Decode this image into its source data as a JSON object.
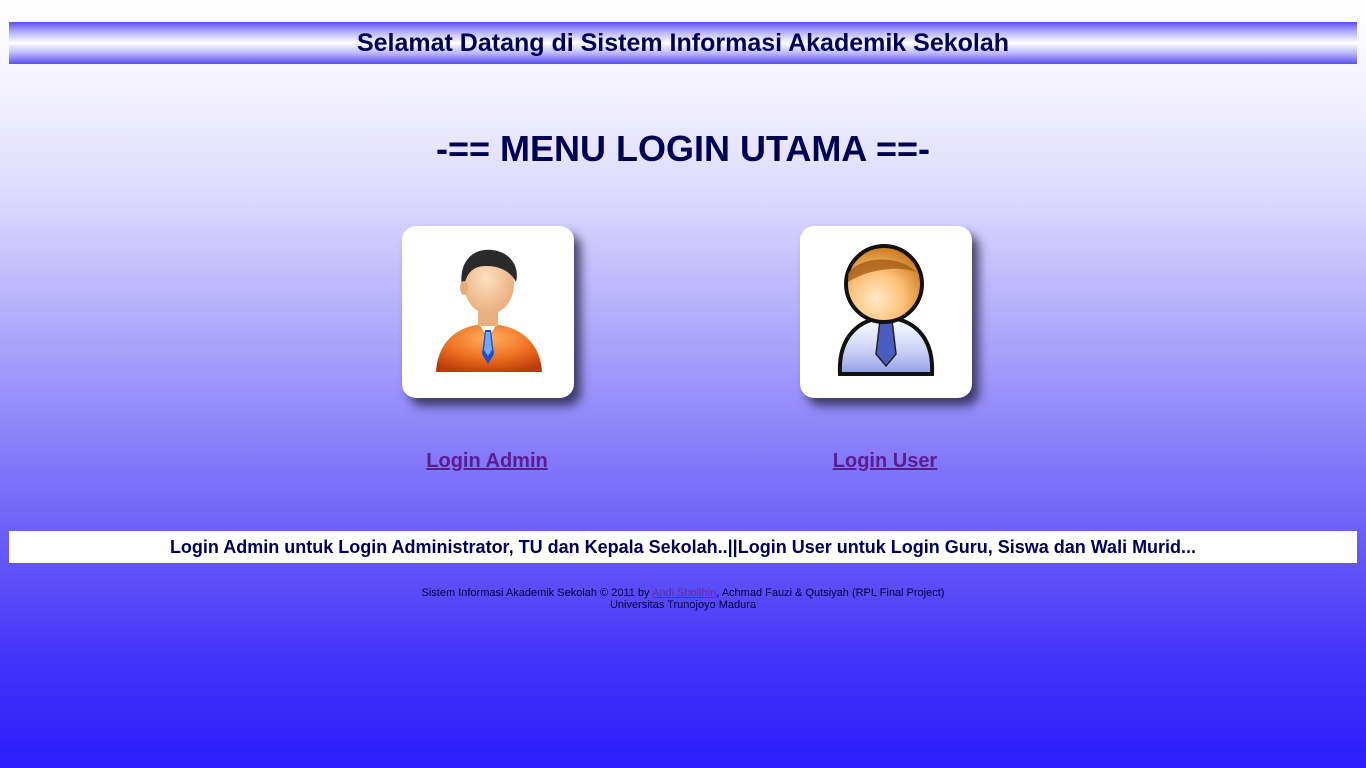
{
  "header": {
    "title": "Selamat Datang di Sistem Informasi Akademik Sekolah"
  },
  "menu": {
    "title": "-== MENU LOGIN UTAMA ==-"
  },
  "logins": {
    "admin": {
      "icon": "admin-user-icon",
      "label": "Login Admin"
    },
    "user": {
      "icon": "user-icon",
      "label": "Login User"
    }
  },
  "info": {
    "admin_text": "Login Admin untuk Login Administrator, TU dan Kepala Sekolah..",
    "separator": "||",
    "user_text": "Login User untuk Login Guru, Siswa dan Wali Murid..."
  },
  "footer": {
    "prefix": "Sistem Informasi Akademik Sekolah © 2011 by ",
    "author_link": "Andi Sholihin",
    "suffix": ", Achmad Fauzi & Qutsiyah (RPL Final Project)",
    "university": "Universitas Trunojoyo Madura"
  },
  "colors": {
    "title_text": "#000055",
    "link": "#5a1d8f",
    "background_top": "#ffffff",
    "background_bottom": "#2b1dfb"
  }
}
